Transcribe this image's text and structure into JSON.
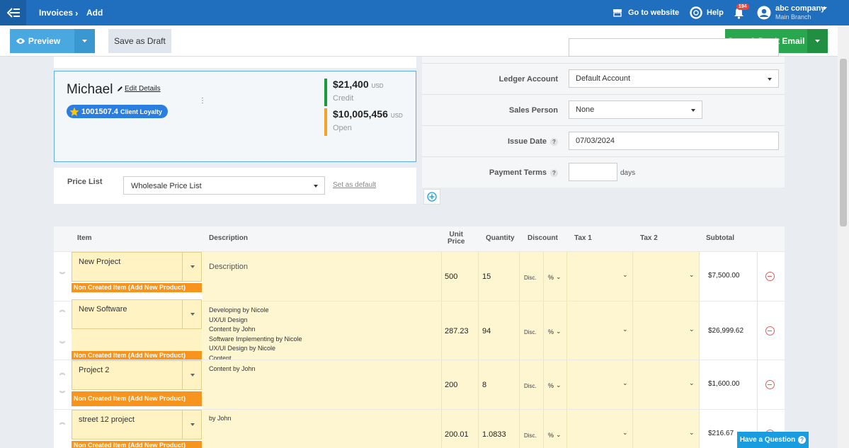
{
  "topbar": {
    "breadcrumb": [
      "Invoices",
      "Add"
    ],
    "go_to_website": "Go to website",
    "help": "Help",
    "notifications_count": "194",
    "company": "abc company",
    "branch": "Main Branch"
  },
  "toolbar": {
    "preview": "Preview",
    "save_draft": "Save as Draft",
    "save_dont_email": "Save & Don't Email"
  },
  "client": {
    "name": "Michael",
    "edit_details": "Edit Details",
    "loyalty_points": "1001507.4",
    "loyalty_label": "Client Loyalty",
    "credit_amount": "$21,400",
    "credit_currency": "USD",
    "credit_label": "Credit",
    "open_amount": "$10,005,456",
    "open_currency": "USD",
    "open_label": "Open"
  },
  "price_list": {
    "label": "Price List",
    "value": "Wholesale Price List",
    "set_default": "Set as default"
  },
  "form": {
    "ledger_label": "Ledger Account",
    "ledger_value": "Default Account",
    "sales_person_label": "Sales Person",
    "sales_person_value": "None",
    "issue_date_label": "Issue Date",
    "issue_date_value": "07/03/2024",
    "payment_terms_label": "Payment Terms",
    "payment_terms_value": "",
    "days_label": "days"
  },
  "table": {
    "headers": {
      "item": "Item",
      "description": "Description",
      "unit_price_1": "Unit",
      "unit_price_2": "Price",
      "quantity": "Quantity",
      "discount": "Discount",
      "tax1": "Tax 1",
      "tax2": "Tax 2",
      "subtotal": "Subtotal"
    },
    "non_created_prefix": "Non Created Item (",
    "add_new_product": "Add New Product",
    "non_created_suffix": ")",
    "discount_label": "Disc.",
    "discount_type": "%",
    "rows": [
      {
        "item": "New Project",
        "description": [
          "Description"
        ],
        "unit_price": "500",
        "quantity": "15",
        "subtotal": "$7,500.00"
      },
      {
        "item": "New Software",
        "description": [
          "Developing by Nicole",
          "UX/UI Design",
          "Content by John",
          "Software Implementing by Nicole",
          "UX/UI Design by Nicole",
          "Content"
        ],
        "unit_price": "287.23",
        "quantity": "94",
        "subtotal": "$26,999.62"
      },
      {
        "item": "Project 2",
        "description": [
          "Content by John"
        ],
        "unit_price": "200",
        "quantity": "8",
        "subtotal": "$1,600.00"
      },
      {
        "item": "street 12 project",
        "description": [
          "by John"
        ],
        "unit_price": "200.01",
        "quantity": "1.0833",
        "subtotal": "$216.67"
      }
    ]
  },
  "help_button": "Have a Question",
  "icons": {
    "menu": "menu-back-icon",
    "website": "store-icon",
    "help": "lifebuoy-icon",
    "notifications": "bell-icon",
    "user": "user-circle-icon",
    "eye": "eye-icon",
    "star": "star-icon",
    "pencil": "pencil-icon",
    "add": "plus-circle-icon",
    "remove": "minus-circle-icon"
  },
  "colors": {
    "topbar": "#1f6fbe",
    "preview": "#4aa8e0",
    "save": "#29a74f",
    "credit_bar": "#1a9a3a",
    "open_bar": "#f2a224",
    "orange": "#f7941d",
    "row_bg": "#fdf6d0"
  }
}
